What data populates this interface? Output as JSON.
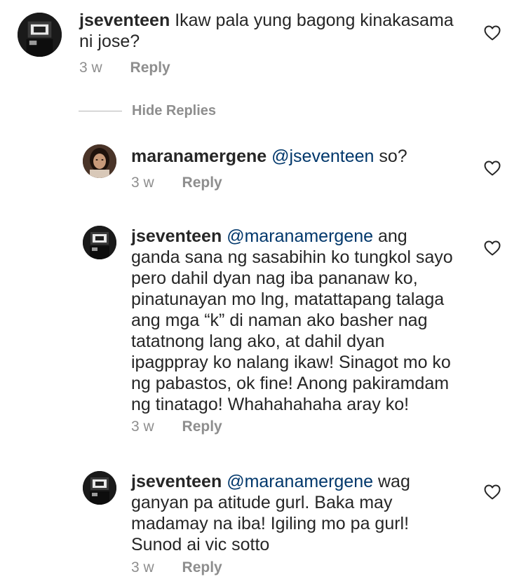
{
  "comments": [
    {
      "username": "jseventeen",
      "mention": "",
      "text": "Ikaw pala yung bagong kinakasama ni jose?",
      "time": "3 w",
      "reply_label": "Reply"
    },
    {
      "username": "maranamergene",
      "mention": "@jseventeen",
      "text": "so?",
      "time": "3 w",
      "reply_label": "Reply"
    },
    {
      "username": "jseventeen",
      "mention": "@maranamergene",
      "text": "ang ganda sana ng sasabihin ko tungkol sayo pero dahil dyan nag iba pananaw ko, pinatunayan mo lng, matattapang talaga ang mga “k” di naman ako basher nag tatatnong lang ako, at dahil dyan ipagppray ko nalang ikaw!  Sinagot mo ko ng pabastos, ok fine! Anong pakiramdam ng tinatago! Whahahahaha aray ko!",
      "time": "3 w",
      "reply_label": "Reply"
    },
    {
      "username": "jseventeen",
      "mention": "@maranamergene",
      "text": "wag ganyan pa atitude gurl. Baka may madamay na iba! Igiling mo pa gurl! Sunod ai vic sotto",
      "time": "3 w",
      "reply_label": "Reply"
    }
  ],
  "hide_replies_label": "Hide Replies",
  "icons": {
    "like": "heart-outline-icon",
    "avatar_jseventeen": "dark-photo-avatar",
    "avatar_maranamergene": "girl-photo-avatar"
  },
  "colors": {
    "text": "#262626",
    "mention": "#00376b",
    "meta": "#8e8e8e"
  }
}
